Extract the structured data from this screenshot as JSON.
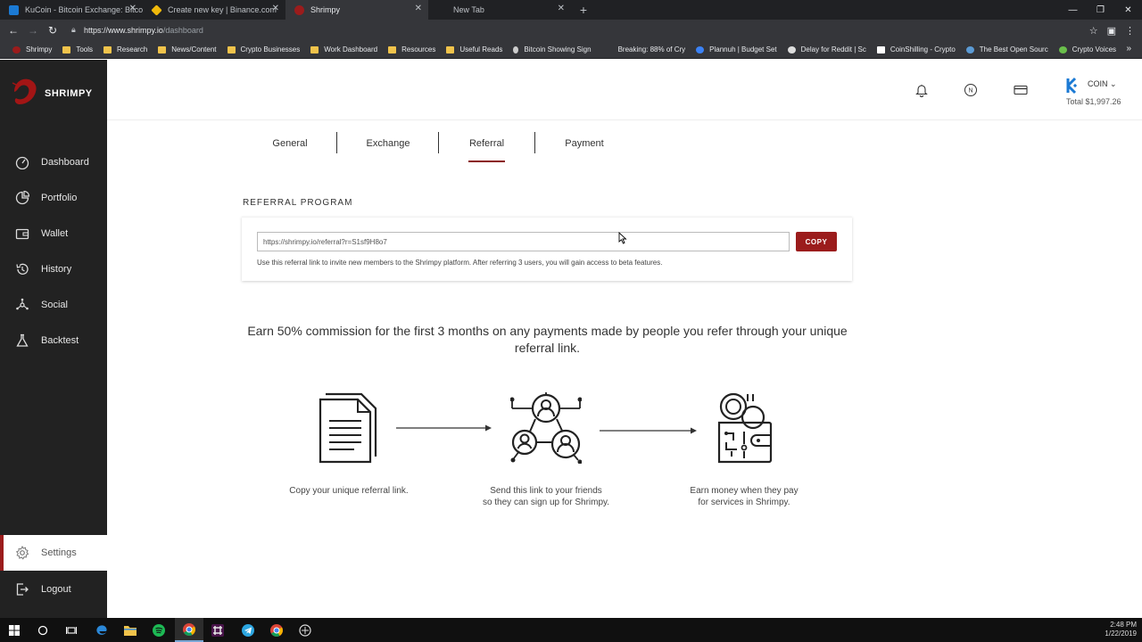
{
  "browser": {
    "tabs": [
      {
        "title": "KuCoin - Bitcoin Exchange: Bitco",
        "favicon_color": "#1b7ad4",
        "active": false
      },
      {
        "title": "Create new key | Binance.com",
        "favicon_color": "#f0b90b",
        "active": false
      },
      {
        "title": "Shrimpy",
        "favicon_color": "#9b1c1c",
        "active": true
      },
      {
        "title": "New Tab",
        "favicon_color": "",
        "active": false
      }
    ],
    "url_host": "https://www.shrimpy.io",
    "url_path": "/dashboard",
    "bookmarks": [
      {
        "label": "Shrimpy",
        "icon": "shrimpy-icon",
        "color": "#9b1c1c"
      },
      {
        "label": "Tools",
        "icon": "folder-icon",
        "color": "#f0c34b"
      },
      {
        "label": "Research",
        "icon": "folder-icon",
        "color": "#f0c34b"
      },
      {
        "label": "News/Content",
        "icon": "folder-icon",
        "color": "#f0c34b"
      },
      {
        "label": "Crypto Businesses",
        "icon": "folder-icon",
        "color": "#f0c34b"
      },
      {
        "label": "Work Dashboard",
        "icon": "folder-icon",
        "color": "#f0c34b"
      },
      {
        "label": "Resources",
        "icon": "folder-icon",
        "color": "#f0c34b"
      },
      {
        "label": "Useful Reads",
        "icon": "folder-icon",
        "color": "#f0c34b"
      },
      {
        "label": "Bitcoin Showing Sign",
        "icon": "drop-icon",
        "color": "#cccccc"
      },
      {
        "label": "Breaking: 88% of Cry",
        "icon": "",
        "color": ""
      },
      {
        "label": "Plannuh | Budget Set",
        "icon": "plannuh-icon",
        "color": "#3b82f6"
      },
      {
        "label": "Delay for Reddit | Sc",
        "icon": "clock-icon",
        "color": "#dddddd"
      },
      {
        "label": "CoinShilling - Crypto",
        "icon": "page-icon",
        "color": "#ffffff"
      },
      {
        "label": "The Best Open Sourc",
        "icon": "c-icon",
        "color": "#5b9bd5"
      },
      {
        "label": "Crypto Voices",
        "icon": "voices-icon",
        "color": "#6abf4b"
      }
    ]
  },
  "app": {
    "brand": "SHRIMPY",
    "nav": [
      {
        "label": "Dashboard",
        "icon": "dashboard-icon"
      },
      {
        "label": "Portfolio",
        "icon": "portfolio-icon"
      },
      {
        "label": "Wallet",
        "icon": "wallet-icon"
      },
      {
        "label": "History",
        "icon": "history-icon"
      },
      {
        "label": "Social",
        "icon": "social-icon"
      },
      {
        "label": "Backtest",
        "icon": "backtest-icon"
      }
    ],
    "settings_label": "Settings",
    "logout_label": "Logout",
    "exchange_name": "COIN",
    "total": "Total $1,997.26",
    "accent": "#9b1c1c"
  },
  "settings": {
    "tabs": [
      "General",
      "Exchange",
      "Referral",
      "Payment"
    ],
    "active_tab": "Referral"
  },
  "referral": {
    "title": "REFERRAL PROGRAM",
    "link": "https://shrimpy.io/referral?r=S1sf9H8o7",
    "copy_label": "COPY",
    "help": "Use this referral link to invite new members to the Shrimpy platform. After referring 3 users, you will gain access to beta features.",
    "headline": "Earn 50% commission for the first 3 months on any payments made by people you refer through your unique referral link.",
    "steps": [
      {
        "line1": "Copy your unique referral link.",
        "line2": ""
      },
      {
        "line1": "Send this link to your friends",
        "line2": "so they can sign up for Shrimpy."
      },
      {
        "line1": "Earn money when they pay",
        "line2": "for services in Shrimpy."
      }
    ]
  },
  "taskbar": {
    "time": "2:48 PM",
    "date": "1/22/2019"
  }
}
